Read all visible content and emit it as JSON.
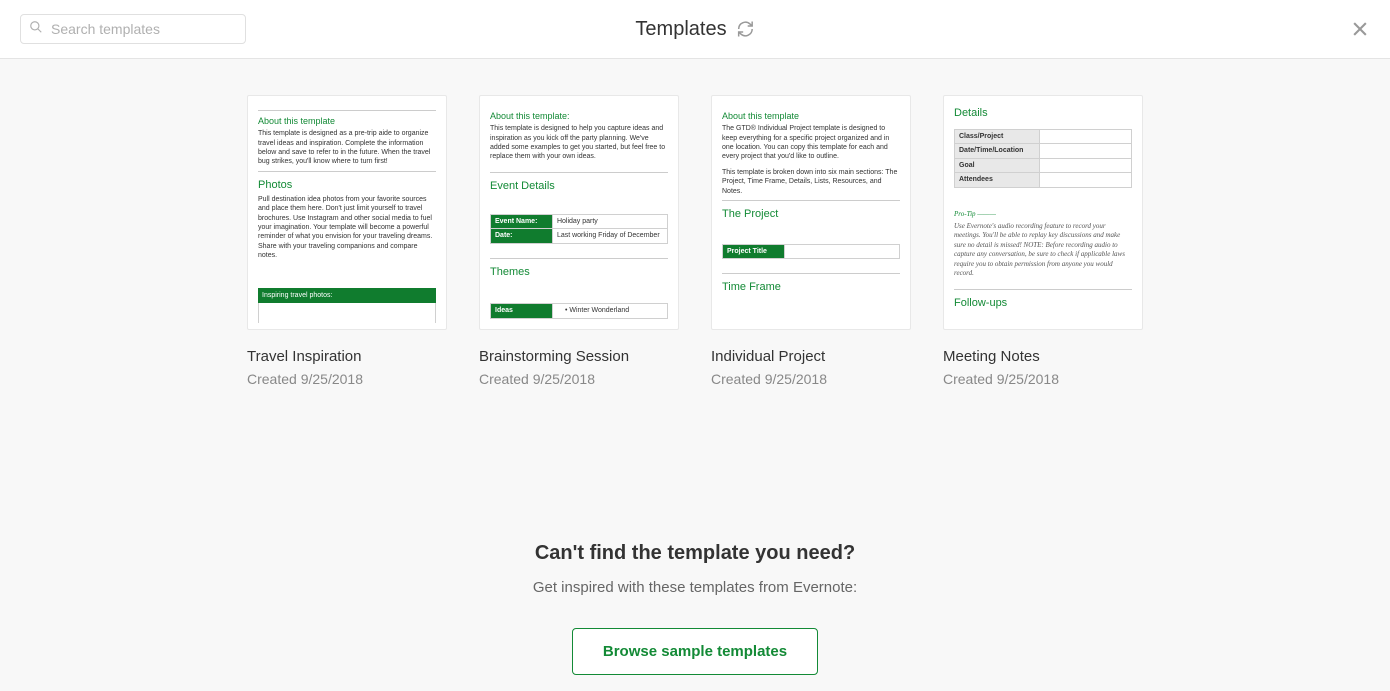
{
  "header": {
    "title": "Templates",
    "search_placeholder": "Search templates"
  },
  "templates": [
    {
      "title": "Travel Inspiration",
      "created": "Created 9/25/2018",
      "preview": {
        "h_about": "About this template",
        "about_text": "This template is designed as a pre-trip aide to organize travel ideas and inspiration.  Complete the information below and save to refer to in the future.  When the travel bug strikes, you'll know where to turn first!",
        "h_photos": "Photos",
        "photos_text": "Pull destination idea photos from your favorite sources and place them here. Don't just limit yourself to travel brochures. Use Instagram and other social media to fuel your imagination. Your template will become a powerful reminder of what you envision for your traveling dreams. Share with your traveling companions and compare notes.",
        "bar": "Inspiring travel photos:"
      }
    },
    {
      "title": "Brainstorming Session",
      "created": "Created 9/25/2018",
      "preview": {
        "h_about": "About this template:",
        "about_text": "This template is designed to help you capture ideas and inspiration as you kick off the party planning. We've added some examples to get you started, but feel free to replace them with your own ideas.",
        "h_event": "Event Details",
        "row1_label": "Event Name:",
        "row1_value": "Holiday party",
        "row2_label": "Date:",
        "row2_value": "Last working Friday of December",
        "h_themes": "Themes",
        "ideas_label": "Ideas",
        "bullet": "Winter Wonderland"
      }
    },
    {
      "title": "Individual Project",
      "created": "Created 9/25/2018",
      "preview": {
        "h_about": "About this template",
        "about_text1": "The GTD® Individual Project template is designed to keep everything for a specific project organized and in one location. You can copy this template for each and every project that you'd like to outline.",
        "about_text2": "This template is broken down into six main sections: The Project, Time Frame, Details, Lists, Resources, and Notes.",
        "h_project": "The Project",
        "project_label": "Project Title",
        "h_timeframe": "Time Frame"
      }
    },
    {
      "title": "Meeting Notes",
      "created": "Created 9/25/2018",
      "preview": {
        "h_details": "Details",
        "row1": "Class/Project",
        "row2": "Date/Time/Location",
        "row3": "Goal",
        "row4": "Attendees",
        "protip_label": "Pro-Tip",
        "protip_text": "Use Evernote's audio recording feature to record your meetings. You'll be able to replay key discussions and make sure no detail is missed! NOTE: Before recording audio to capture any conversation, be sure to check if applicable laws require you to obtain permission from anyone you would record.",
        "h_followups": "Follow-ups"
      }
    }
  ],
  "footer": {
    "heading": "Can't find the template you need?",
    "subtext": "Get inspired with these templates from Evernote:",
    "button": "Browse sample templates"
  }
}
